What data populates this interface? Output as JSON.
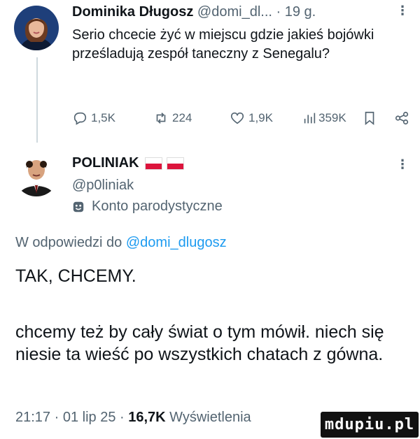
{
  "parent": {
    "name": "Dominika Długosz",
    "handle": "@domi_dl...",
    "time": "· 19 g.",
    "text": "Serio chcecie żyć w miejscu gdzie jakieś bojówki prześladują zespół taneczny z Senegalu?",
    "actions": {
      "replies": "1,5K",
      "reposts": "224",
      "likes": "1,9K",
      "views": "359K"
    }
  },
  "reply": {
    "name": "POLINIAK",
    "handle": "@p0liniak",
    "parody_label": "Konto parodystyczne",
    "in_reply_prefix": "W odpowiedzi do",
    "in_reply_handle": "@domi_dlugosz",
    "text_line1": "TAK, CHCEMY.",
    "text_body": "chcemy też by cały świat o tym mówił. niech się niesie ta wieść po wszystkich chatach z gówna.",
    "time": "21:17 · 01 lip 25 ·",
    "views_count": "16,7K",
    "views_label": "Wyświetlenia"
  },
  "watermark": "mdupiu.pl",
  "colors": {
    "text": "#0f1419",
    "muted": "#536471",
    "link": "#1d9bf0",
    "flag_red": "#dc143c"
  },
  "icons": [
    "reply-icon",
    "repost-icon",
    "like-icon",
    "views-icon",
    "bookmark-icon",
    "share-icon",
    "parody-icon",
    "more-icon"
  ]
}
